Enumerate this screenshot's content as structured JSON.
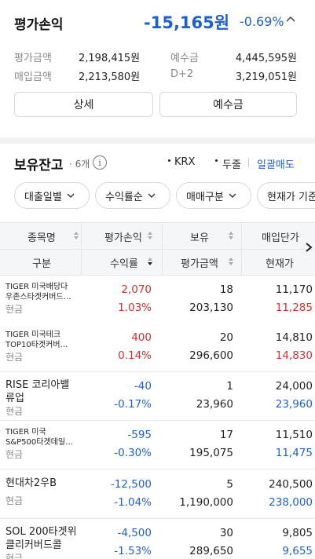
{
  "summary": {
    "title": "평가손익",
    "amount": "-15,165원",
    "rate": "-0.69%",
    "eval_amount_label": "평가금액",
    "eval_amount_value": "2,198,415원",
    "purchase_amount_label": "매입금액",
    "purchase_amount_value": "2,213,580원",
    "deposit_label": "예수금",
    "deposit_value": "4,445,595원",
    "d2_label": "D+2",
    "d2_value": "3,219,051원",
    "detail_button": "상세",
    "deposit_button": "예수금"
  },
  "holdings": {
    "title": "보유잔고",
    "count": "· 6개",
    "info_glyph": "i",
    "opt_krx": "KRX",
    "opt_dugeul": "두줄",
    "opt_bulk_sell": "일괄매도",
    "filters": [
      "대출일별",
      "수익률순",
      "매매구분",
      "현재가 기준"
    ]
  },
  "table": {
    "headers_top": [
      "종목명",
      "평가손익",
      "보유",
      "매입단가"
    ],
    "headers_bottom": [
      "구분",
      "수익률",
      "평가금액",
      "현재가"
    ],
    "rows": [
      {
        "name1": "TIGER 미국배당다",
        "name2": "우존스타겟커버드…",
        "type": "현금",
        "pl": "2,070",
        "rate": "1.03%",
        "qty": "18",
        "eval": "203,130",
        "buy": "11,170",
        "cur": "11,285",
        "dir": "up",
        "big": false
      },
      {
        "name1": "TIGER 미국테크",
        "name2": "TOP10타겟커버…",
        "type": "현금",
        "pl": "400",
        "rate": "0.14%",
        "qty": "20",
        "eval": "296,600",
        "buy": "14,810",
        "cur": "14,830",
        "dir": "up",
        "big": false
      },
      {
        "name1": "RISE 코리아밸",
        "name2": "류업",
        "type": "현금",
        "pl": "-40",
        "rate": "-0.17%",
        "qty": "1",
        "eval": "23,960",
        "buy": "24,000",
        "cur": "23,960",
        "dir": "down",
        "big": true
      },
      {
        "name1": "TIGER 미국",
        "name2": "S&P500타겟데일…",
        "type": "현금",
        "pl": "-595",
        "rate": "-0.30%",
        "qty": "17",
        "eval": "195,075",
        "buy": "11,510",
        "cur": "11,475",
        "dir": "down",
        "big": false
      },
      {
        "name1": "현대차2우B",
        "name2": "",
        "type": "현금",
        "pl": "-12,500",
        "rate": "-1.04%",
        "qty": "5",
        "eval": "1,190,000",
        "buy": "240,500",
        "cur": "238,000",
        "dir": "down",
        "big": true
      },
      {
        "name1": "SOL 200타겟위",
        "name2": "클리커버드콜",
        "type": "현금",
        "pl": "-4,500",
        "rate": "-1.53%",
        "qty": "30",
        "eval": "289,650",
        "buy": "9,805",
        "cur": "9,655",
        "dir": "down",
        "big": true
      }
    ]
  },
  "colors": {
    "accent_blue": "#1f5fd6",
    "loss_blue": "#1f5fd6",
    "gain_red": "#d32f2f"
  }
}
